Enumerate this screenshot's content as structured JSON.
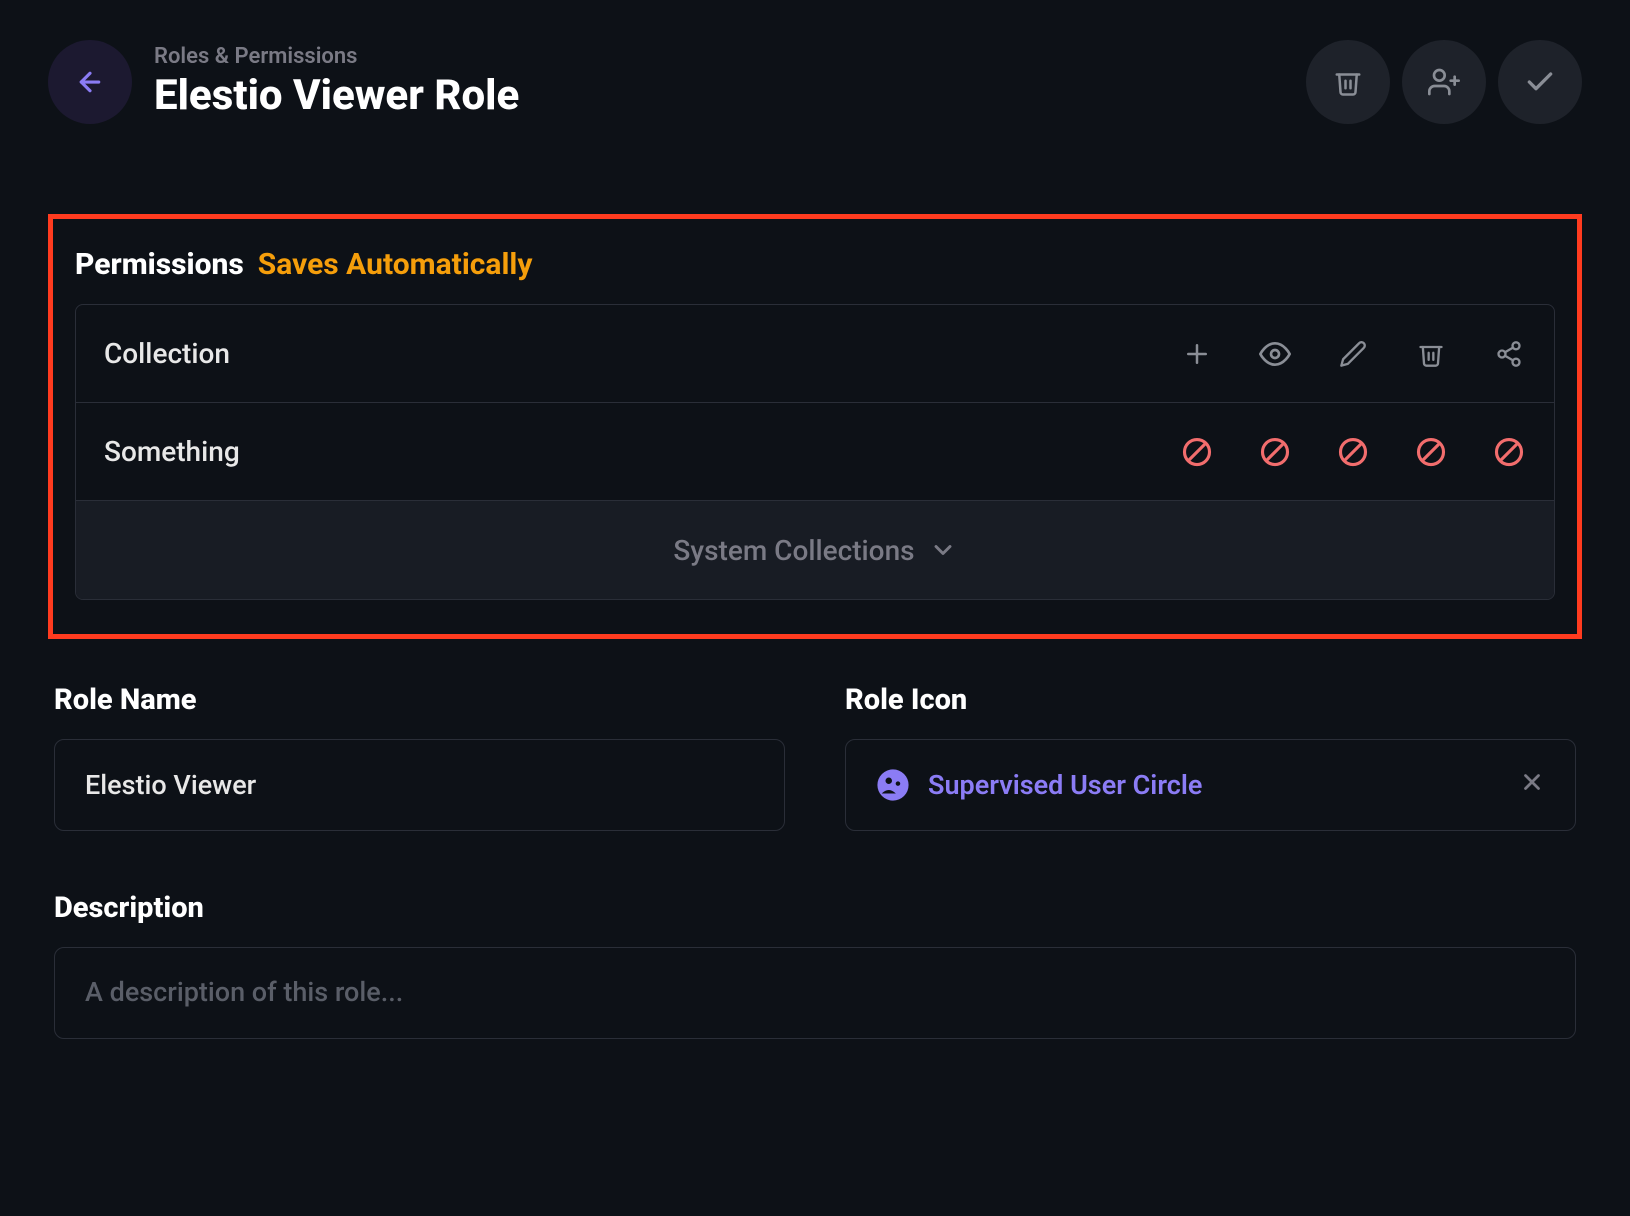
{
  "header": {
    "breadcrumb": "Roles & Permissions",
    "title": "Elestio Viewer Role"
  },
  "permissions": {
    "title": "Permissions",
    "subtitle": "Saves Automatically",
    "header_label": "Collection",
    "rows": [
      {
        "label": "Something"
      }
    ],
    "system_label": "System Collections"
  },
  "fields": {
    "role_name": {
      "label": "Role Name",
      "value": "Elestio Viewer"
    },
    "role_icon": {
      "label": "Role Icon",
      "value": "Supervised User Circle"
    },
    "description": {
      "label": "Description",
      "placeholder": "A description of this role..."
    }
  },
  "colors": {
    "accent": "#8b7cf5",
    "warning": "#f59e0b",
    "deny": "#f87171"
  }
}
